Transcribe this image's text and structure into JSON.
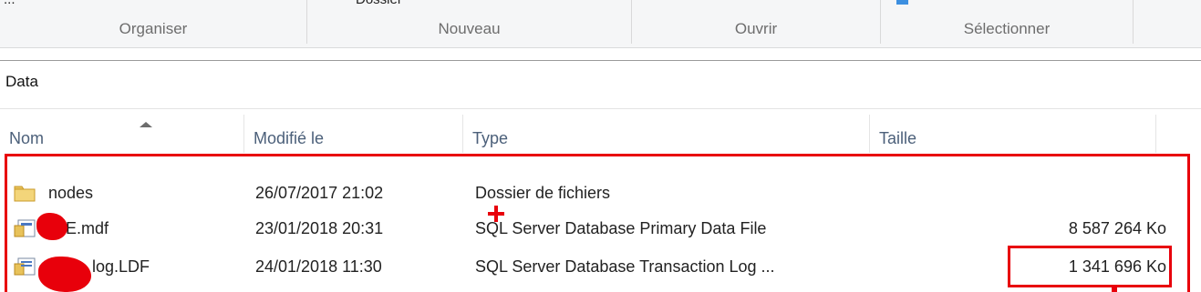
{
  "ribbon": {
    "groups": [
      "Organiser",
      "Nouveau",
      "Ouvrir",
      "Sélectionner"
    ],
    "partial_top_labels": [
      "...",
      "Dossier"
    ]
  },
  "address": {
    "path": "Data"
  },
  "columns": {
    "name": "Nom",
    "modified": "Modifié le",
    "type": "Type",
    "size": "Taille"
  },
  "files": [
    {
      "name": "nodes",
      "modified": "26/07/2017 21:02",
      "type": "Dossier de fichiers",
      "size": "",
      "icon": "folder-icon"
    },
    {
      "name": "E.mdf",
      "modified": "23/01/2018 20:31",
      "type": "SQL Server Database Primary Data File",
      "size": "8 587 264 Ko",
      "icon": "database-file-icon"
    },
    {
      "name": "log.LDF",
      "modified": "24/01/2018 11:30",
      "type": "SQL Server Database Transaction Log ...",
      "size": "1 341 696 Ko",
      "icon": "database-log-icon"
    }
  ],
  "colors": {
    "annotation": "#e8000b",
    "header_text": "#4c607a",
    "ribbon_bg": "#f5f6f7"
  }
}
